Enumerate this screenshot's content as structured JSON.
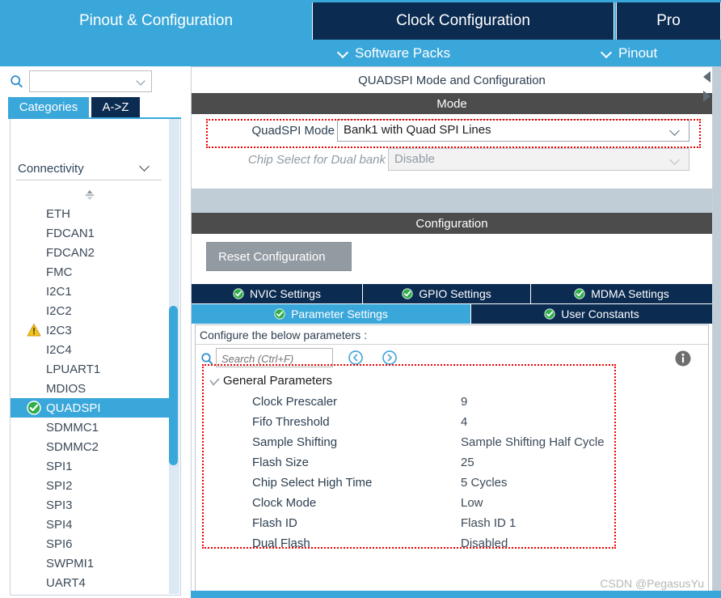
{
  "tabs": [
    {
      "label": "Pinout & Configuration",
      "active": true
    },
    {
      "label": "Clock Configuration",
      "active": false
    },
    {
      "label": "Pro",
      "active": false
    }
  ],
  "submenu": [
    {
      "label": "Software Packs"
    },
    {
      "label": "Pinout"
    }
  ],
  "sidebar": {
    "search": {
      "value": "",
      "placeholder": ""
    },
    "gear_icon": "gear-icon",
    "search_icon": "search-icon",
    "view_tabs": [
      {
        "label": "Categories",
        "active": true
      },
      {
        "label": "A->Z",
        "active": false
      }
    ],
    "group": {
      "label": "Connectivity"
    },
    "items": [
      {
        "label": "ETH",
        "status": "none"
      },
      {
        "label": "FDCAN1",
        "status": "none"
      },
      {
        "label": "FDCAN2",
        "status": "none"
      },
      {
        "label": "FMC",
        "status": "none"
      },
      {
        "label": "I2C1",
        "status": "none"
      },
      {
        "label": "I2C2",
        "status": "none"
      },
      {
        "label": "I2C3",
        "status": "warning"
      },
      {
        "label": "I2C4",
        "status": "none"
      },
      {
        "label": "LPUART1",
        "status": "none"
      },
      {
        "label": "MDIOS",
        "status": "none"
      },
      {
        "label": "QUADSPI",
        "status": "ok",
        "selected": true
      },
      {
        "label": "SDMMC1",
        "status": "none"
      },
      {
        "label": "SDMMC2",
        "status": "none"
      },
      {
        "label": "SPI1",
        "status": "none"
      },
      {
        "label": "SPI2",
        "status": "none"
      },
      {
        "label": "SPI3",
        "status": "none"
      },
      {
        "label": "SPI4",
        "status": "none"
      },
      {
        "label": "SPI6",
        "status": "none"
      },
      {
        "label": "SWPMI1",
        "status": "none"
      },
      {
        "label": "UART4",
        "status": "none"
      }
    ]
  },
  "main": {
    "title": "QUADSPI Mode and Configuration",
    "mode_header": "Mode",
    "config_header": "Configuration",
    "mode_rows": [
      {
        "label": "QuadSPI Mode",
        "value": "Bank1 with Quad SPI Lines",
        "disabled": false
      },
      {
        "label": "Chip Select for Dual bank",
        "value": "Disable",
        "disabled": true
      }
    ],
    "reset_button": "Reset Configuration",
    "config_tabs_row1": [
      {
        "label": "NVIC Settings",
        "active": false
      },
      {
        "label": "GPIO Settings",
        "active": false
      },
      {
        "label": "MDMA Settings",
        "active": false
      }
    ],
    "config_tabs_row2": [
      {
        "label": "Parameter Settings",
        "active": true
      },
      {
        "label": "User Constants",
        "active": false
      }
    ],
    "configure_hint": "Configure the below parameters :",
    "param_search": {
      "value": "",
      "placeholder": "Search (Ctrl+F)"
    },
    "history_back_icon": "history-back-icon",
    "history_forward_icon": "history-forward-icon",
    "info_icon": "info-icon",
    "param_group": "General Parameters",
    "parameters": [
      {
        "name": "Clock Prescaler",
        "value": "9"
      },
      {
        "name": "Fifo Threshold",
        "value": "4"
      },
      {
        "name": "Sample Shifting",
        "value": "Sample Shifting Half Cycle"
      },
      {
        "name": "Flash Size",
        "value": "25"
      },
      {
        "name": "Chip Select High Time",
        "value": "5 Cycles"
      },
      {
        "name": "Clock Mode",
        "value": "Low"
      },
      {
        "name": "Flash ID",
        "value": "Flash ID 1"
      },
      {
        "name": "Dual Flash",
        "value": "Disabled"
      }
    ]
  },
  "watermark": "CSDN @PegasusYu",
  "colors": {
    "accent": "#3aa7da",
    "dark": "#0b2b51",
    "barDark": "#4c4c4c",
    "highlight": "#ee0000"
  }
}
